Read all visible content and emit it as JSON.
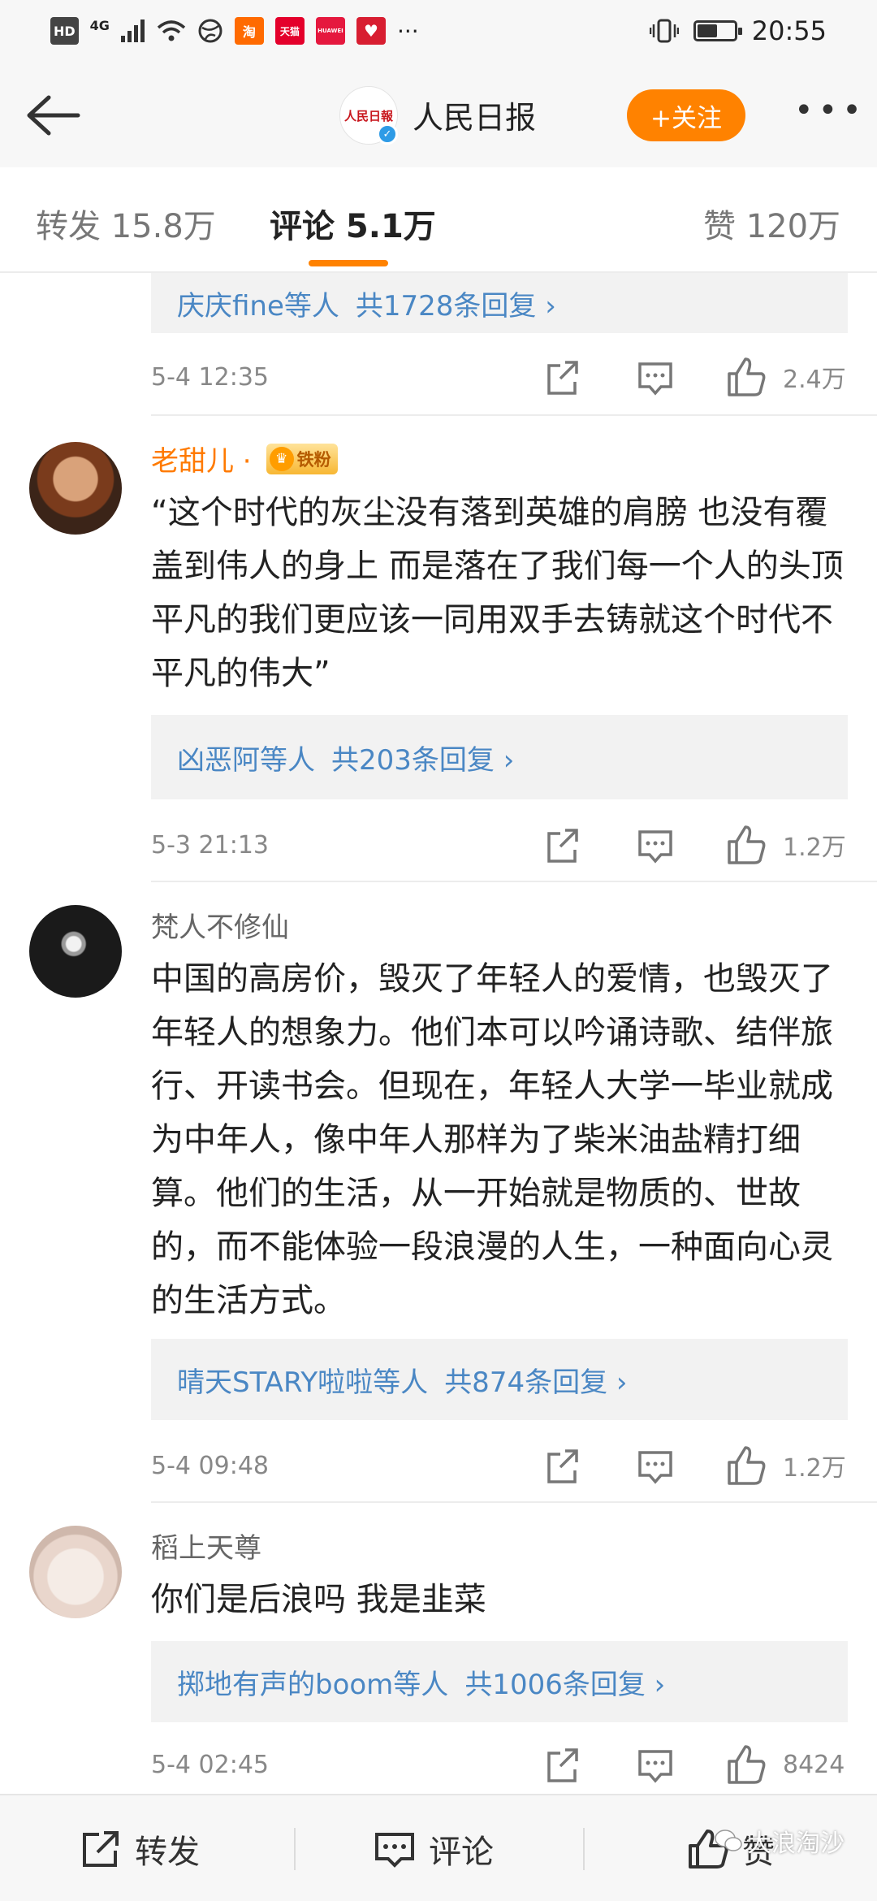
{
  "status_bar": {
    "left_items": [
      "HD",
      "4G"
    ],
    "app_badges": [
      {
        "name": "taobao-app-icon",
        "label": "淘",
        "color": "#ff6a00"
      },
      {
        "name": "tmall-app-icon",
        "label": "天猫",
        "color": "#e4002b"
      },
      {
        "name": "huawei-app-icon",
        "label": "HUAWEI",
        "color": "#e5183e"
      },
      {
        "name": "health-app-icon",
        "label": "♥",
        "color": "#d81e31"
      }
    ],
    "dots": "···",
    "time": "20:55",
    "battery_level": 0.55
  },
  "navbar": {
    "logo_text": "人民日報",
    "title": "人民日报",
    "follow_label": "+关注",
    "more_label": "•••"
  },
  "tabs": {
    "repost": "转发 15.8万",
    "comments": "评论 5.1万",
    "likes": "赞 120万"
  },
  "comments": [
    {
      "reply_users": "庆庆fine等人",
      "reply_count": "共1728条回复 ›",
      "time": "5-4 12:35",
      "likes": "2.4万"
    },
    {
      "username": "老甜儿 ·",
      "badge": "铁粉",
      "text": "“这个时代的灰尘没有落到英雄的肩膀 也没有覆盖到伟人的身上 而是落在了我们每一个人的头顶 平凡的我们更应该一同用双手去铸就这个时代不平凡的伟大”",
      "reply_users": "凶恶阿等人",
      "reply_count": "共203条回复 ›",
      "time": "5-3 21:13",
      "likes": "1.2万"
    },
    {
      "username": "梵人不修仙",
      "text": "中国的高房价，毁灭了年轻人的爱情，也毁灭了年轻人的想象力。他们本可以吟诵诗歌、结伴旅行、开读书会。但现在，年轻人大学一毕业就成为中年人，像中年人那样为了柴米油盐精打细算。他们的生活，从一开始就是物质的、世故的，而不能体验一段浪漫的人生，一种面向心灵的生活方式。",
      "reply_users": "晴天STARY啦啦等人",
      "reply_count": "共874条回复 ›",
      "time": "5-4 09:48",
      "likes": "1.2万"
    },
    {
      "username": "稻上天尊",
      "text": "你们是后浪吗 我是韭菜",
      "reply_users": "掷地有声的boom等人",
      "reply_count": "共1006条回复 ›",
      "time": "5-4 02:45",
      "likes": "8424"
    }
  ],
  "bottom_bar": {
    "repost": "转发",
    "comment": "评论",
    "like": "赞"
  },
  "watermark": "大浪淘沙"
}
